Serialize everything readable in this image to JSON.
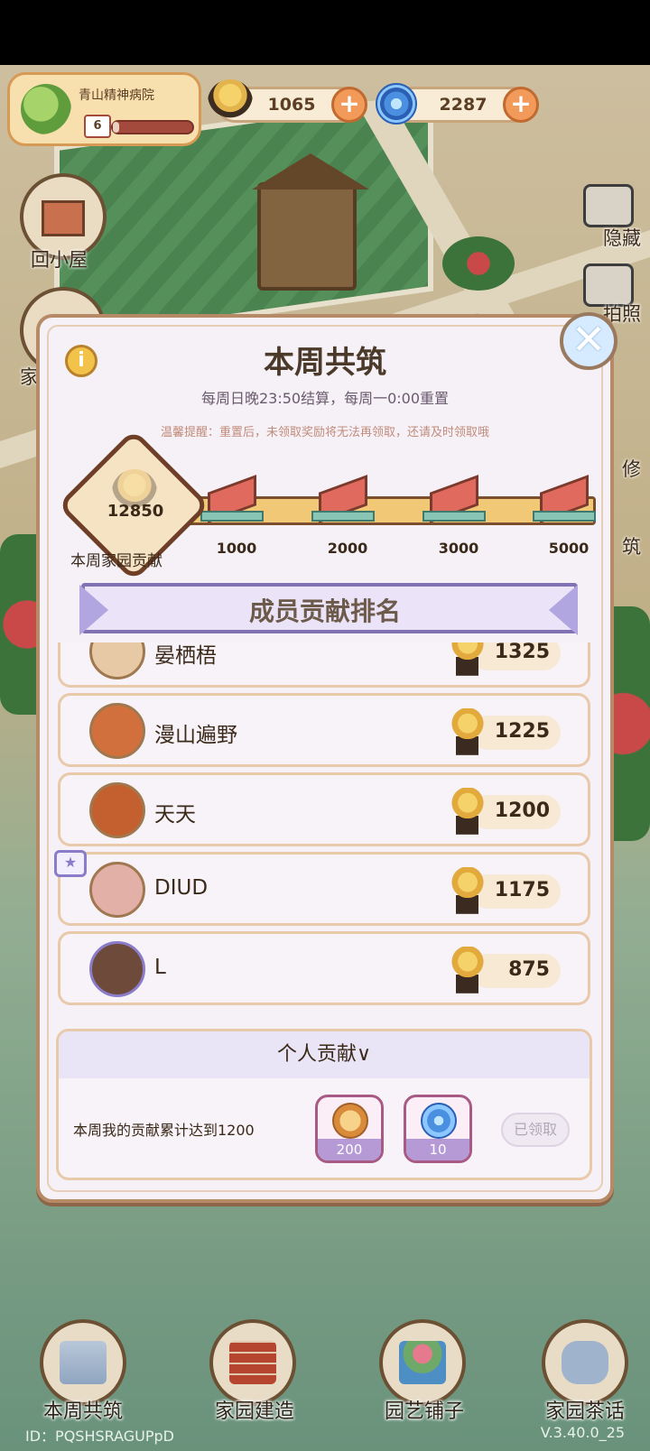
{
  "location": {
    "name": "青山精神病院",
    "level": "6",
    "level_progress": 0.08
  },
  "resources": {
    "snail_count": "1065",
    "swirl_count": "2287"
  },
  "left_menu": [
    {
      "label": "回小屋"
    },
    {
      "label": "家"
    }
  ],
  "right_menu": [
    {
      "label": "隐藏"
    },
    {
      "label": "拍照"
    },
    {
      "label": "修"
    },
    {
      "label": "筑"
    }
  ],
  "modal": {
    "title": "本周共筑",
    "subtitle": "每周日晚23:50结算，每周一0:00重置",
    "note": "温馨提醒：重置后，未领取奖励将无法再领取，还请及时领取哦",
    "info_icon": "i",
    "close_icon": "✕",
    "total_value": "12850",
    "total_label": "本周家园贡献",
    "progress": 1.0,
    "milestones": [
      "1000",
      "2000",
      "3000",
      "5000"
    ]
  },
  "ranking": {
    "title": "成员贡献排名",
    "rows": [
      {
        "name": "晏栖梧",
        "score": "1325"
      },
      {
        "name": "漫山遍野",
        "score": "1225"
      },
      {
        "name": "天天",
        "score": "1200"
      },
      {
        "name": "DIUD",
        "score": "1175"
      },
      {
        "name": "L",
        "score": "875"
      }
    ]
  },
  "personal": {
    "title": "个人贡献∨",
    "goal_text": "本周我的贡献累计达到1200",
    "rewards": [
      {
        "qty": "200",
        "icon": "coin-icon"
      },
      {
        "qty": "10",
        "icon": "swirl-icon"
      }
    ],
    "claim_label": "已领取"
  },
  "bottom_nav": [
    {
      "label": "本周共筑"
    },
    {
      "label": "家园建造"
    },
    {
      "label": "园艺铺子"
    },
    {
      "label": "家园茶话"
    }
  ],
  "footer": {
    "id_text": "ID：PQSHSRAGUPpD",
    "version": "V.3.40.0_25"
  },
  "colors": {
    "accent_brown": "#6b5033",
    "banner_purple": "#7f73b3",
    "ribbon_red": "#e06a5e",
    "progress_gold": "#e9be6a"
  }
}
